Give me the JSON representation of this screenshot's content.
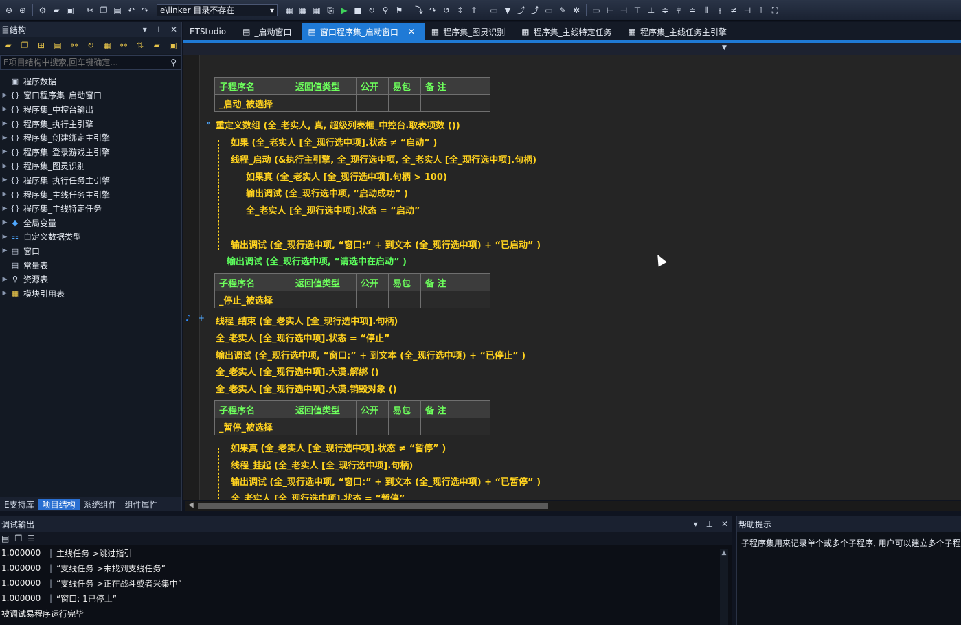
{
  "toolbar": {
    "combo_value": "e\\linker 目录不存在",
    "icons": [
      "back-icon",
      "forward-icon",
      "settings-icon",
      "open-folder-icon",
      "save-icon",
      "cut-icon",
      "copy-icon",
      "paste-icon",
      "undo-icon",
      "redo-icon",
      "compile-icon",
      "build-icon",
      "run-icon",
      "stop-icon",
      "restart-icon",
      "debug-icon",
      "step-icon",
      "bookmark-icon",
      "tool-icon",
      "align-icon"
    ]
  },
  "left_panel": {
    "title": "目结构",
    "search_placeholder": "E项目结构中搜索,回车键确定...",
    "tree": [
      {
        "label": "程序数据",
        "icon": "data-icon",
        "expander": ""
      },
      {
        "label": "窗口程序集_启动窗口",
        "icon": "braces-icon",
        "expander": "▶"
      },
      {
        "label": "程序集_中控台输出",
        "icon": "braces-icon",
        "expander": "▶"
      },
      {
        "label": "程序集_执行主引擎",
        "icon": "braces-icon",
        "expander": "▶"
      },
      {
        "label": "程序集_创建绑定主引擎",
        "icon": "braces-icon",
        "expander": "▶"
      },
      {
        "label": "程序集_登录游戏主引擎",
        "icon": "braces-icon",
        "expander": "▶"
      },
      {
        "label": "程序集_图灵识别",
        "icon": "braces-icon",
        "expander": "▶"
      },
      {
        "label": "程序集_执行任务主引擎",
        "icon": "braces-icon",
        "expander": "▶"
      },
      {
        "label": "程序集_主线任务主引擎",
        "icon": "braces-icon",
        "expander": "▶"
      },
      {
        "label": "程序集_主线特定任务",
        "icon": "braces-icon",
        "expander": "▶"
      },
      {
        "label": "全局变量",
        "icon": "globe-icon",
        "expander": "▶"
      },
      {
        "label": "自定义数据类型",
        "icon": "type-icon",
        "expander": "▶"
      },
      {
        "label": "窗口",
        "icon": "window-icon",
        "expander": "▶"
      },
      {
        "label": "常量表",
        "icon": "constant-icon",
        "expander": ""
      },
      {
        "label": "资源表",
        "icon": "resource-icon",
        "expander": "▶"
      },
      {
        "label": "模块引用表",
        "icon": "module-icon",
        "expander": "▶"
      }
    ],
    "tabs": [
      "E支持库",
      "项目结构",
      "系统组件",
      "组件属性"
    ],
    "active_tab": "项目结构"
  },
  "doc_tabs": [
    {
      "label": "ETStudio",
      "icon": ""
    },
    {
      "label": "_启动窗口",
      "icon": "form-icon"
    },
    {
      "label": "窗口程序集_启动窗口",
      "icon": "form-icon",
      "active": true
    },
    {
      "label": "程序集_图灵识别",
      "icon": "module-icon"
    },
    {
      "label": "程序集_主线特定任务",
      "icon": "module-icon"
    },
    {
      "label": "程序集_主线任务主引擎",
      "icon": "module-icon"
    }
  ],
  "proc_headers": [
    "子程序名",
    "返回值类型",
    "公开",
    "易包",
    "备 注"
  ],
  "procs": [
    {
      "name": "_启动_被选择"
    },
    {
      "name": "_停止_被选择"
    },
    {
      "name": "_暂停_被选择"
    }
  ],
  "code": {
    "l1": "重定义数组 (全_老实人, 真, 超级列表框_中控台.取表项数 ())",
    "l2": "如果 (全_老实人 [全_现行选中项].状态 ≠ “启动” )",
    "l3": "线程_启动 (&执行主引擎, 全_现行选中项, 全_老实人 [全_现行选中项].句柄)",
    "l4": "如果真 (全_老实人 [全_现行选中项].句柄 > 100)",
    "l5": "输出调试 (全_现行选中项, “启动成功” )",
    "l6": "全_老实人 [全_现行选中项].状态 = “启动”",
    "l7": "输出调试 (全_现行选中项, “窗口:” + 到文本 (全_现行选中项) + “已启动” )",
    "l8": "输出调试 (全_现行选中项, “请选中在启动” )",
    "l9": "线程_结束 (全_老实人 [全_现行选中项].句柄)",
    "l10": "全_老实人 [全_现行选中项].状态 = “停止”",
    "l11": "输出调试 (全_现行选中项, “窗口:” + 到文本 (全_现行选中项) + “已停止” )",
    "l12": "全_老实人 [全_现行选中项].大漠.解绑 ()",
    "l13": "全_老实人 [全_现行选中项].大漠.销毁对象 ()",
    "l14": "如果真 (全_老实人 [全_现行选中项].状态 ≠ “暂停” )",
    "l15": "线程_挂起 (全_老实人 [全_现行选中项].句柄)",
    "l16": "输出调试 (全_现行选中项, “窗口:” + 到文本 (全_现行选中项) + “已暂停” )",
    "l17": "全_老实人 [全_现行选中项].状态 = “暂停”"
  },
  "output_panel": {
    "title": "调试输出",
    "rows": [
      {
        "time": "1.000000",
        "text": "主线任务->跳过指引"
      },
      {
        "time": "1.000000",
        "text": "“支线任务->未找到支线任务”"
      },
      {
        "time": "1.000000",
        "text": "“支线任务->正在战斗或者采集中”"
      },
      {
        "time": "1.000000",
        "text": "“窗口: 1已停止”"
      }
    ],
    "footer": "被调试易程序运行完毕"
  },
  "help_panel": {
    "title": "帮助提示",
    "text": "子程序集用来记录单个或多个子程序, 用户可以建立多个子程序"
  },
  "colors": {
    "keyword": "#ffd21e",
    "string": "#ff5a5a",
    "header_text": "#6dff5c",
    "tab_active": "#1f7ad6"
  }
}
